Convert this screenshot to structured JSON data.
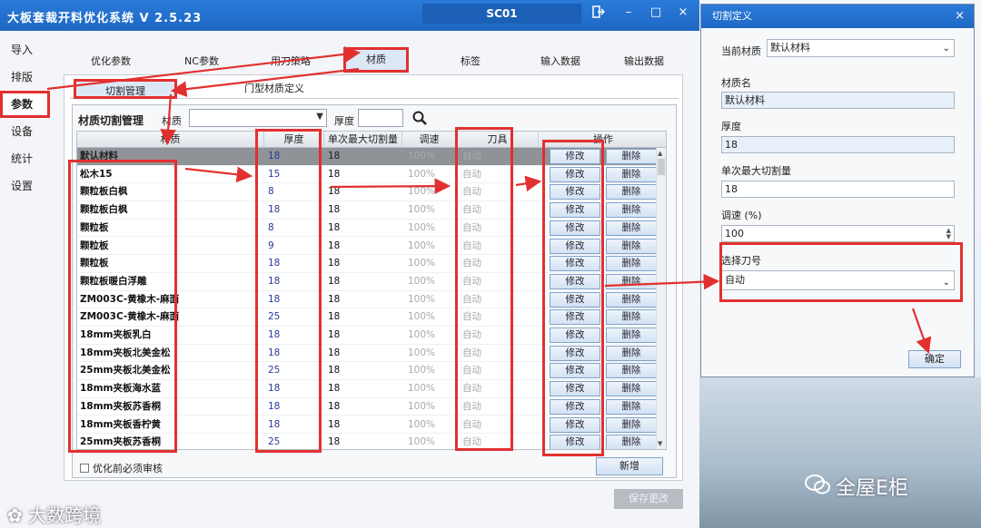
{
  "app": {
    "title": "大板套裁开料优化系统 V 2.5.23",
    "machine": "SC01",
    "window_controls": [
      "exit",
      "minimize",
      "maximize",
      "close"
    ]
  },
  "leftnav": {
    "items": [
      {
        "label": "导入"
      },
      {
        "label": "排版"
      },
      {
        "label": "参数",
        "active": true
      },
      {
        "label": "设备"
      },
      {
        "label": "统计"
      },
      {
        "label": "设置"
      }
    ]
  },
  "tabs": {
    "items": [
      {
        "label": "优化参数"
      },
      {
        "label": "NC参数"
      },
      {
        "label": "用刀策略"
      },
      {
        "label": "材质",
        "active": true
      },
      {
        "label": "标签"
      },
      {
        "label": "输入数据"
      },
      {
        "label": "输出数据"
      }
    ]
  },
  "subtabs": {
    "items": [
      {
        "label": "切割管理",
        "active": true
      },
      {
        "label": "门型材质定义"
      }
    ]
  },
  "panel": {
    "title": "材质切割管理",
    "material_label": "材质",
    "material_value": "",
    "thickness_label": "厚度",
    "thickness_value": ""
  },
  "table": {
    "headers": [
      "材质",
      "厚度",
      "单次最大切割量",
      "调速",
      "刀具",
      "操作"
    ],
    "edit_label": "修改",
    "delete_label": "删除",
    "rows": [
      {
        "name": "默认材料",
        "thickness": "18",
        "max_cut": "18",
        "speed": "100%",
        "tool": "自动",
        "selected": true
      },
      {
        "name": "松木15",
        "thickness": "15",
        "max_cut": "18",
        "speed": "100%",
        "tool": "自动"
      },
      {
        "name": "颗粒板白枫",
        "thickness": "8",
        "max_cut": "18",
        "speed": "100%",
        "tool": "自动"
      },
      {
        "name": "颗粒板白枫",
        "thickness": "18",
        "max_cut": "18",
        "speed": "100%",
        "tool": "自动"
      },
      {
        "name": "颗粒板",
        "thickness": "8",
        "max_cut": "18",
        "speed": "100%",
        "tool": "自动"
      },
      {
        "name": "颗粒板",
        "thickness": "9",
        "max_cut": "18",
        "speed": "100%",
        "tool": "自动"
      },
      {
        "name": "颗粒板",
        "thickness": "18",
        "max_cut": "18",
        "speed": "100%",
        "tool": "自动"
      },
      {
        "name": "颗粒板暖白浮雕",
        "thickness": "18",
        "max_cut": "18",
        "speed": "100%",
        "tool": "自动"
      },
      {
        "name": "ZM003C-黄橡木-麻面",
        "thickness": "18",
        "max_cut": "18",
        "speed": "100%",
        "tool": "自动"
      },
      {
        "name": "ZM003C-黄橡木-麻面",
        "thickness": "25",
        "max_cut": "18",
        "speed": "100%",
        "tool": "自动"
      },
      {
        "name": "18mm夹板乳白",
        "thickness": "18",
        "max_cut": "18",
        "speed": "100%",
        "tool": "自动"
      },
      {
        "name": "18mm夹板北美金松",
        "thickness": "18",
        "max_cut": "18",
        "speed": "100%",
        "tool": "自动"
      },
      {
        "name": "25mm夹板北美金松",
        "thickness": "25",
        "max_cut": "18",
        "speed": "100%",
        "tool": "自动"
      },
      {
        "name": "18mm夹板海水蓝",
        "thickness": "18",
        "max_cut": "18",
        "speed": "100%",
        "tool": "自动"
      },
      {
        "name": "18mm夹板苏香桐",
        "thickness": "18",
        "max_cut": "18",
        "speed": "100%",
        "tool": "自动"
      },
      {
        "name": "18mm夹板香柠黄",
        "thickness": "18",
        "max_cut": "18",
        "speed": "100%",
        "tool": "自动"
      },
      {
        "name": "25mm夹板苏香桐",
        "thickness": "25",
        "max_cut": "18",
        "speed": "100%",
        "tool": "自动"
      }
    ]
  },
  "footer": {
    "audit_label": "优化前必须审核",
    "audit_checked": false,
    "add_label": "新增",
    "save_label": "保存更改"
  },
  "dialog": {
    "title": "切割定义",
    "close": "×",
    "current_material_label": "当前材质",
    "current_material_value": "默认材料",
    "material_name_label": "材质名",
    "material_name_value": "默认材料",
    "thickness_label": "厚度",
    "thickness_value": "18",
    "max_cut_label": "单次最大切割量",
    "max_cut_value": "18",
    "speed_label": "调速 (%)",
    "speed_value": "100",
    "tool_label": "选择刀号",
    "tool_value": "自动",
    "ok_label": "确定"
  },
  "watermarks": {
    "left": "大数跨境",
    "right": "全屋E柜"
  },
  "colors": {
    "title_bar": "#1e68c4",
    "highlight": "#e23030",
    "selected_row": "#8f9296",
    "thickness_text": "#2a3a9a"
  }
}
